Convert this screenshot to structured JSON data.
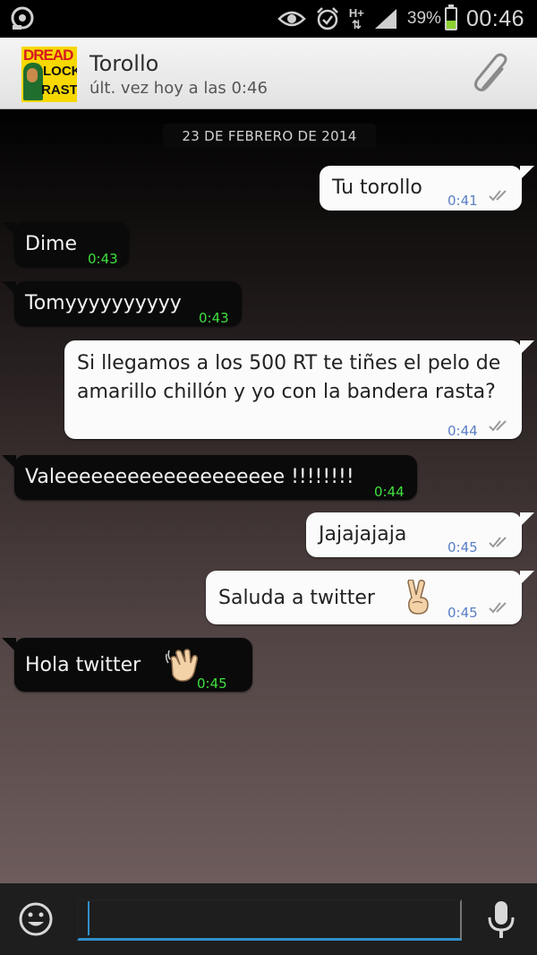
{
  "status_bar": {
    "battery_text": "39%",
    "network_type": "H+",
    "time": "00:46",
    "battery_level": 0.39
  },
  "contact": {
    "name": "Torollo",
    "last_seen": "últ. vez hoy a las 0:46",
    "avatar_lines": [
      "DREAD",
      "LOCK",
      "RASTA"
    ]
  },
  "chat": {
    "date_separator": "23 DE FEBRERO DE 2014",
    "messages": [
      {
        "direction": "out",
        "text": "Tu torollo",
        "time": "0:41",
        "emoji": ""
      },
      {
        "direction": "in",
        "text": "Dime",
        "time": "0:43",
        "emoji": ""
      },
      {
        "direction": "in",
        "text": "Tomyyyyyyyyyy",
        "time": "0:43",
        "emoji": ""
      },
      {
        "direction": "out",
        "text": "Si llegamos a los 500 RT te tiñes el pelo de amarillo chillón y yo con la bandera rasta?",
        "time": "0:44",
        "emoji": ""
      },
      {
        "direction": "in",
        "text": "Valeeeeeeeeeeeeeeeeeee !!!!!!!!",
        "time": "0:44",
        "emoji": ""
      },
      {
        "direction": "out",
        "text": "Jajajajaja",
        "time": "0:45",
        "emoji": ""
      },
      {
        "direction": "out",
        "text": "Saluda a twitter",
        "time": "0:45",
        "emoji": "victory-hand"
      },
      {
        "direction": "in",
        "text": "Hola twitter",
        "time": "0:45",
        "emoji": "waving-hand"
      }
    ]
  },
  "input": {
    "value": "",
    "placeholder": ""
  },
  "colors": {
    "outgoing_bubble": "#fbfbfb",
    "incoming_bubble": "#0a0a0a",
    "outgoing_time": "#5a7fc4",
    "incoming_time": "#3fe03f",
    "input_underline": "#2f8fc9"
  }
}
